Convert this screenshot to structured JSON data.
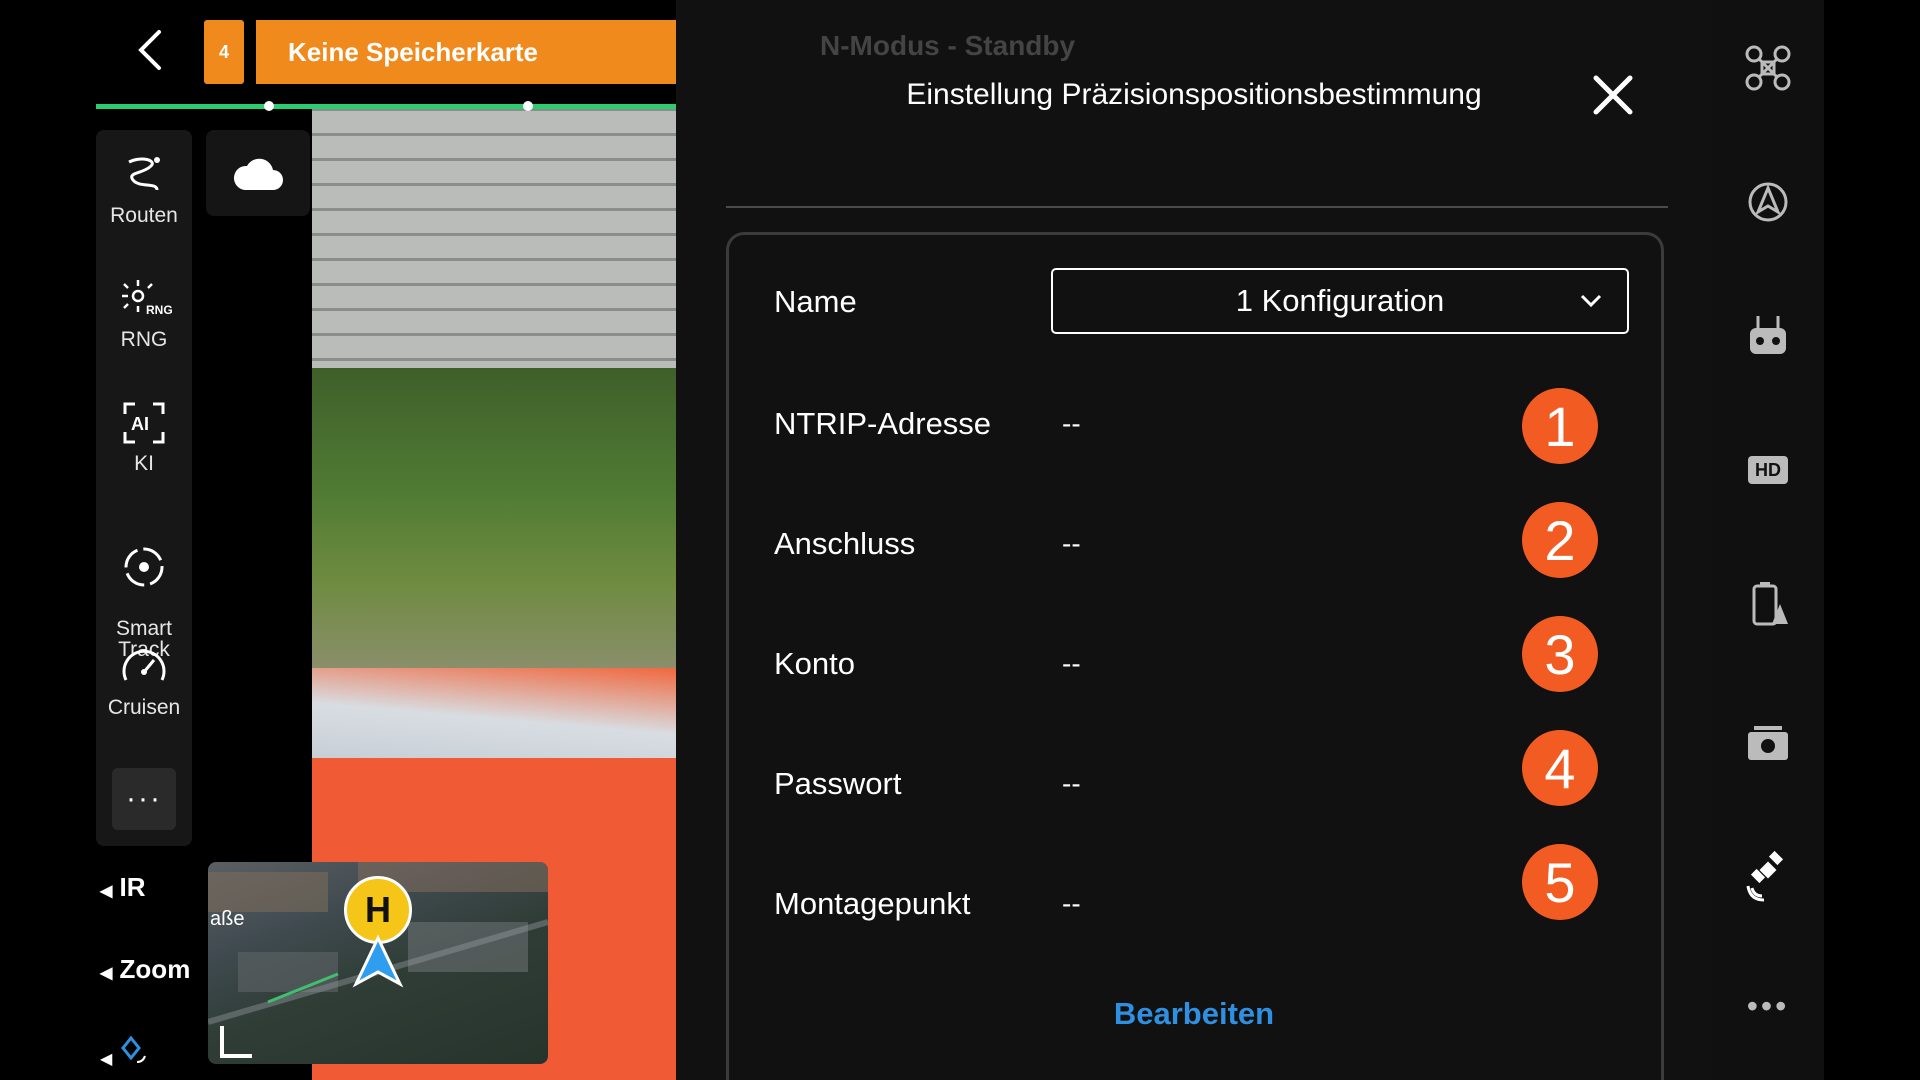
{
  "topbar": {
    "badge_count": "4",
    "warning_text": "Keine Speicherkarte",
    "background_status": "N-Modus - Standby"
  },
  "left_rail": {
    "items": [
      {
        "label": "Routen",
        "icon": "route-icon"
      },
      {
        "label": "RNG",
        "icon": "rng-icon"
      },
      {
        "label": "KI",
        "icon": "ai-icon"
      },
      {
        "label": "Smart\nTrack",
        "icon": "smart-track-icon"
      },
      {
        "label": "Cruisen",
        "icon": "speedometer-icon"
      }
    ],
    "more_label": "···"
  },
  "side_controls": {
    "ir_label": "IR",
    "zoom_label": "Zoom"
  },
  "minimap": {
    "street_fragment": "aße",
    "home_marker": "H"
  },
  "dialog": {
    "title": "Einstellung Präzisionspositionsbestimmung",
    "fields": [
      {
        "label": "Name",
        "value": "1 Konfiguration",
        "type": "select"
      },
      {
        "label": "NTRIP-Adresse",
        "value": "--",
        "annotation": "1"
      },
      {
        "label": "Anschluss",
        "value": "--",
        "annotation": "2"
      },
      {
        "label": "Konto",
        "value": "--",
        "annotation": "3"
      },
      {
        "label": "Passwort",
        "value": "--",
        "annotation": "4"
      },
      {
        "label": "Montagepunkt",
        "value": "--",
        "annotation": "5"
      }
    ],
    "edit_label": "Bearbeiten"
  },
  "right_rail": {
    "icons": [
      "drone-icon",
      "flight-mode-icon",
      "remote-controller-icon",
      "hd-icon",
      "battery-alert-icon",
      "camera-icon",
      "satellite-icon",
      "more-icon"
    ],
    "hd_label": "HD"
  },
  "colors": {
    "accent_orange": "#f08a1c",
    "annotation_orange": "#f25c23",
    "link_blue": "#2f8fe0",
    "progress_green": "#2ecc71"
  }
}
